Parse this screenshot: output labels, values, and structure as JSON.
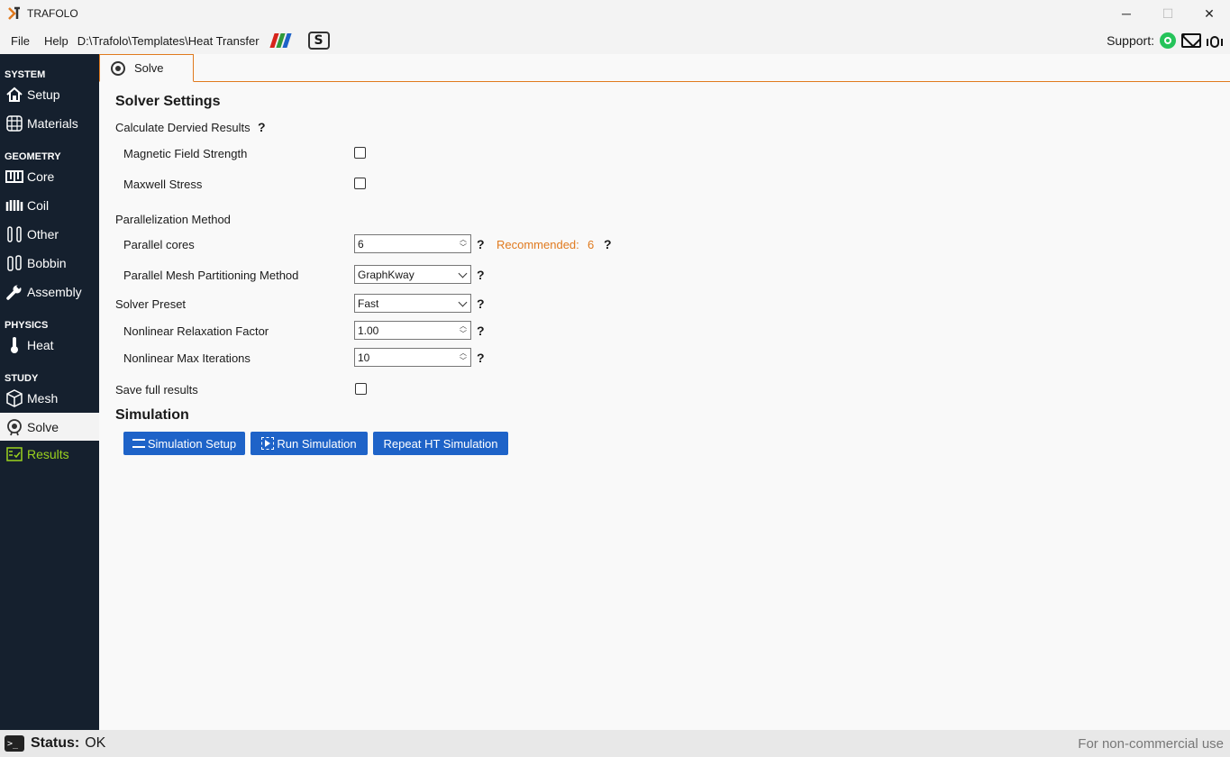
{
  "app": {
    "title": "TRAFOLO"
  },
  "window_controls": {
    "minimize": "─",
    "maximize": "☐",
    "close": "✕"
  },
  "menu": {
    "file": "File",
    "help": "Help",
    "path": "D:\\Trafolo\\Templates\\Heat Transfer",
    "logo2_text": "S"
  },
  "support": {
    "label": "Support:",
    "icons": [
      "whatsapp-icon",
      "mail-icon",
      "bug-icon"
    ]
  },
  "sidebar": {
    "sections": {
      "system": "SYSTEM",
      "geometry": "GEOMETRY",
      "physics": "PHYSICS",
      "study": "STUDY"
    },
    "items": {
      "setup": {
        "label": "Setup",
        "icon": "home-icon"
      },
      "materials": {
        "label": "Materials",
        "icon": "grid-icon"
      },
      "core": {
        "label": "Core",
        "icon": "core-icon"
      },
      "coil": {
        "label": "Coil",
        "icon": "coil-icon"
      },
      "other": {
        "label": "Other",
        "icon": "other-icon"
      },
      "bobbin": {
        "label": "Bobbin",
        "icon": "bobbin-icon"
      },
      "assembly": {
        "label": "Assembly",
        "icon": "wrench-icon"
      },
      "heat": {
        "label": "Heat",
        "icon": "thermometer-icon"
      },
      "mesh": {
        "label": "Mesh",
        "icon": "cube-icon"
      },
      "solve": {
        "label": "Solve",
        "icon": "solve-icon"
      },
      "results": {
        "label": "Results",
        "icon": "results-icon"
      }
    },
    "colors": {
      "background": "#15202e",
      "results_accent": "#9bd21e"
    }
  },
  "tab": {
    "label": "Solve"
  },
  "solver": {
    "heading": "Solver Settings",
    "derived": {
      "label": "Calculate Dervied Results",
      "help": "?"
    },
    "magnetic_field": {
      "label": "Magnetic Field Strength",
      "checked": false
    },
    "maxwell": {
      "label": "Maxwell Stress",
      "checked": false
    },
    "parallelization": {
      "label": "Parallelization Method"
    },
    "parallel_cores": {
      "label": "Parallel cores",
      "value": "6",
      "help": "?",
      "recommended_label": "Recommended:",
      "recommended_value": "6",
      "recommended_help": "?"
    },
    "mesh_partitioning": {
      "label": "Parallel Mesh Partitioning Method",
      "value": "GraphKway",
      "help": "?"
    },
    "preset": {
      "label": "Solver Preset",
      "value": "Fast",
      "help": "?"
    },
    "relaxation": {
      "label": "Nonlinear Relaxation Factor",
      "value": "1.00",
      "help": "?"
    },
    "max_iterations": {
      "label": "Nonlinear Max Iterations",
      "value": "10",
      "help": "?"
    },
    "save_full": {
      "label": "Save full results",
      "checked": false
    }
  },
  "simulation": {
    "heading": "Simulation",
    "setup_button": "Simulation Setup",
    "run_button": "Run Simulation",
    "repeat_button": "Repeat HT Simulation",
    "button_color": "#1e63c8"
  },
  "status": {
    "label": "Status:",
    "value": "OK",
    "license": "For non-commercial use",
    "terminal_glyph": ">_"
  },
  "colors": {
    "accent_orange": "#e07a1e"
  }
}
